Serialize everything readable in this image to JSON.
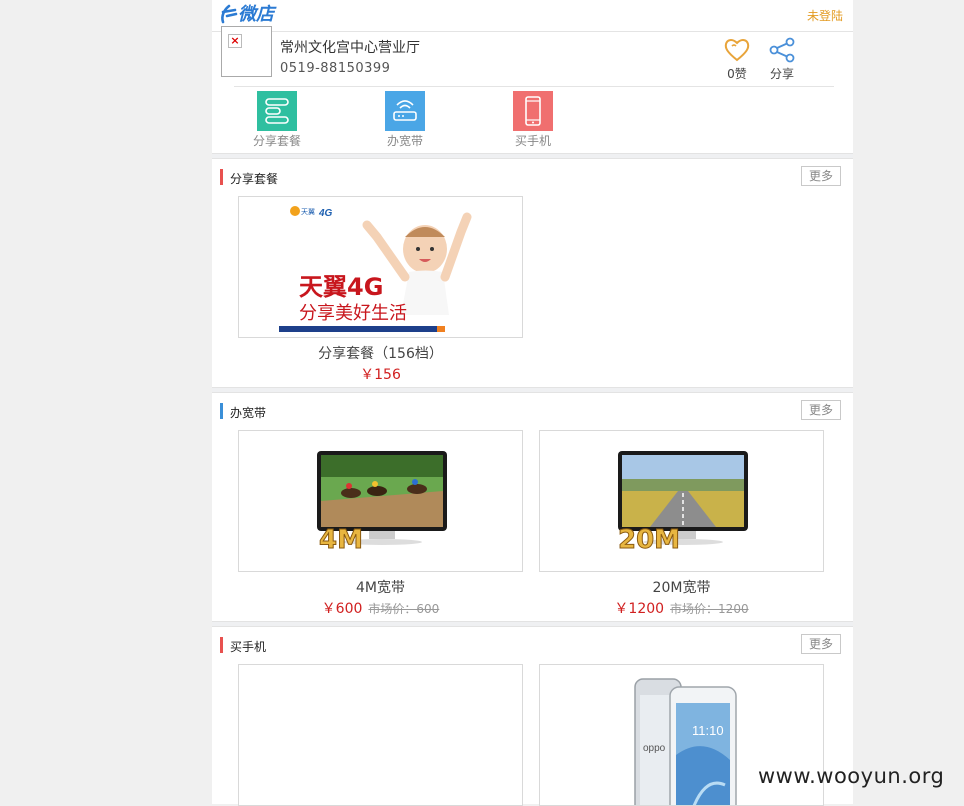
{
  "header": {
    "logo_text": "微店",
    "login_label": "未登陆"
  },
  "store": {
    "name": "常州文化宫中心营业厅",
    "phone": "0519-88150399",
    "like_label": "0赞",
    "share_label": "分享"
  },
  "nav": [
    {
      "label": "分享套餐",
      "icon": "package-icon",
      "color": "#2fbfa0"
    },
    {
      "label": "办宽带",
      "icon": "router-icon",
      "color": "#4aa6e6"
    },
    {
      "label": "买手机",
      "icon": "phone-icon",
      "color": "#f06f6f"
    }
  ],
  "sections": [
    {
      "title": "分享套餐",
      "bar_color": "#e8514f",
      "more": "更多",
      "items": [
        {
          "title": "分享套餐（156档）",
          "price": "￥156",
          "banner_brand": "天翼",
          "banner_4g": "4G",
          "banner_line1": "天翼4G",
          "banner_line2": "分享美好生活"
        }
      ]
    },
    {
      "title": "办宽带",
      "bar_color": "#3a8fd8",
      "more": "更多",
      "items": [
        {
          "title": "4M宽带",
          "price": "￥600",
          "market_price": "市场价：600",
          "speed": "4M"
        },
        {
          "title": "20M宽带",
          "price": "￥1200",
          "market_price": "市场价：1200",
          "speed": "20M"
        }
      ]
    },
    {
      "title": "买手机",
      "bar_color": "#e8514f",
      "more": "更多",
      "items": [
        {
          "title": "",
          "price": ""
        },
        {
          "title": "",
          "price": "",
          "phone_brand": "oppo",
          "screen_time": "11:10"
        }
      ]
    }
  ],
  "watermark": "www.wooyun.org"
}
